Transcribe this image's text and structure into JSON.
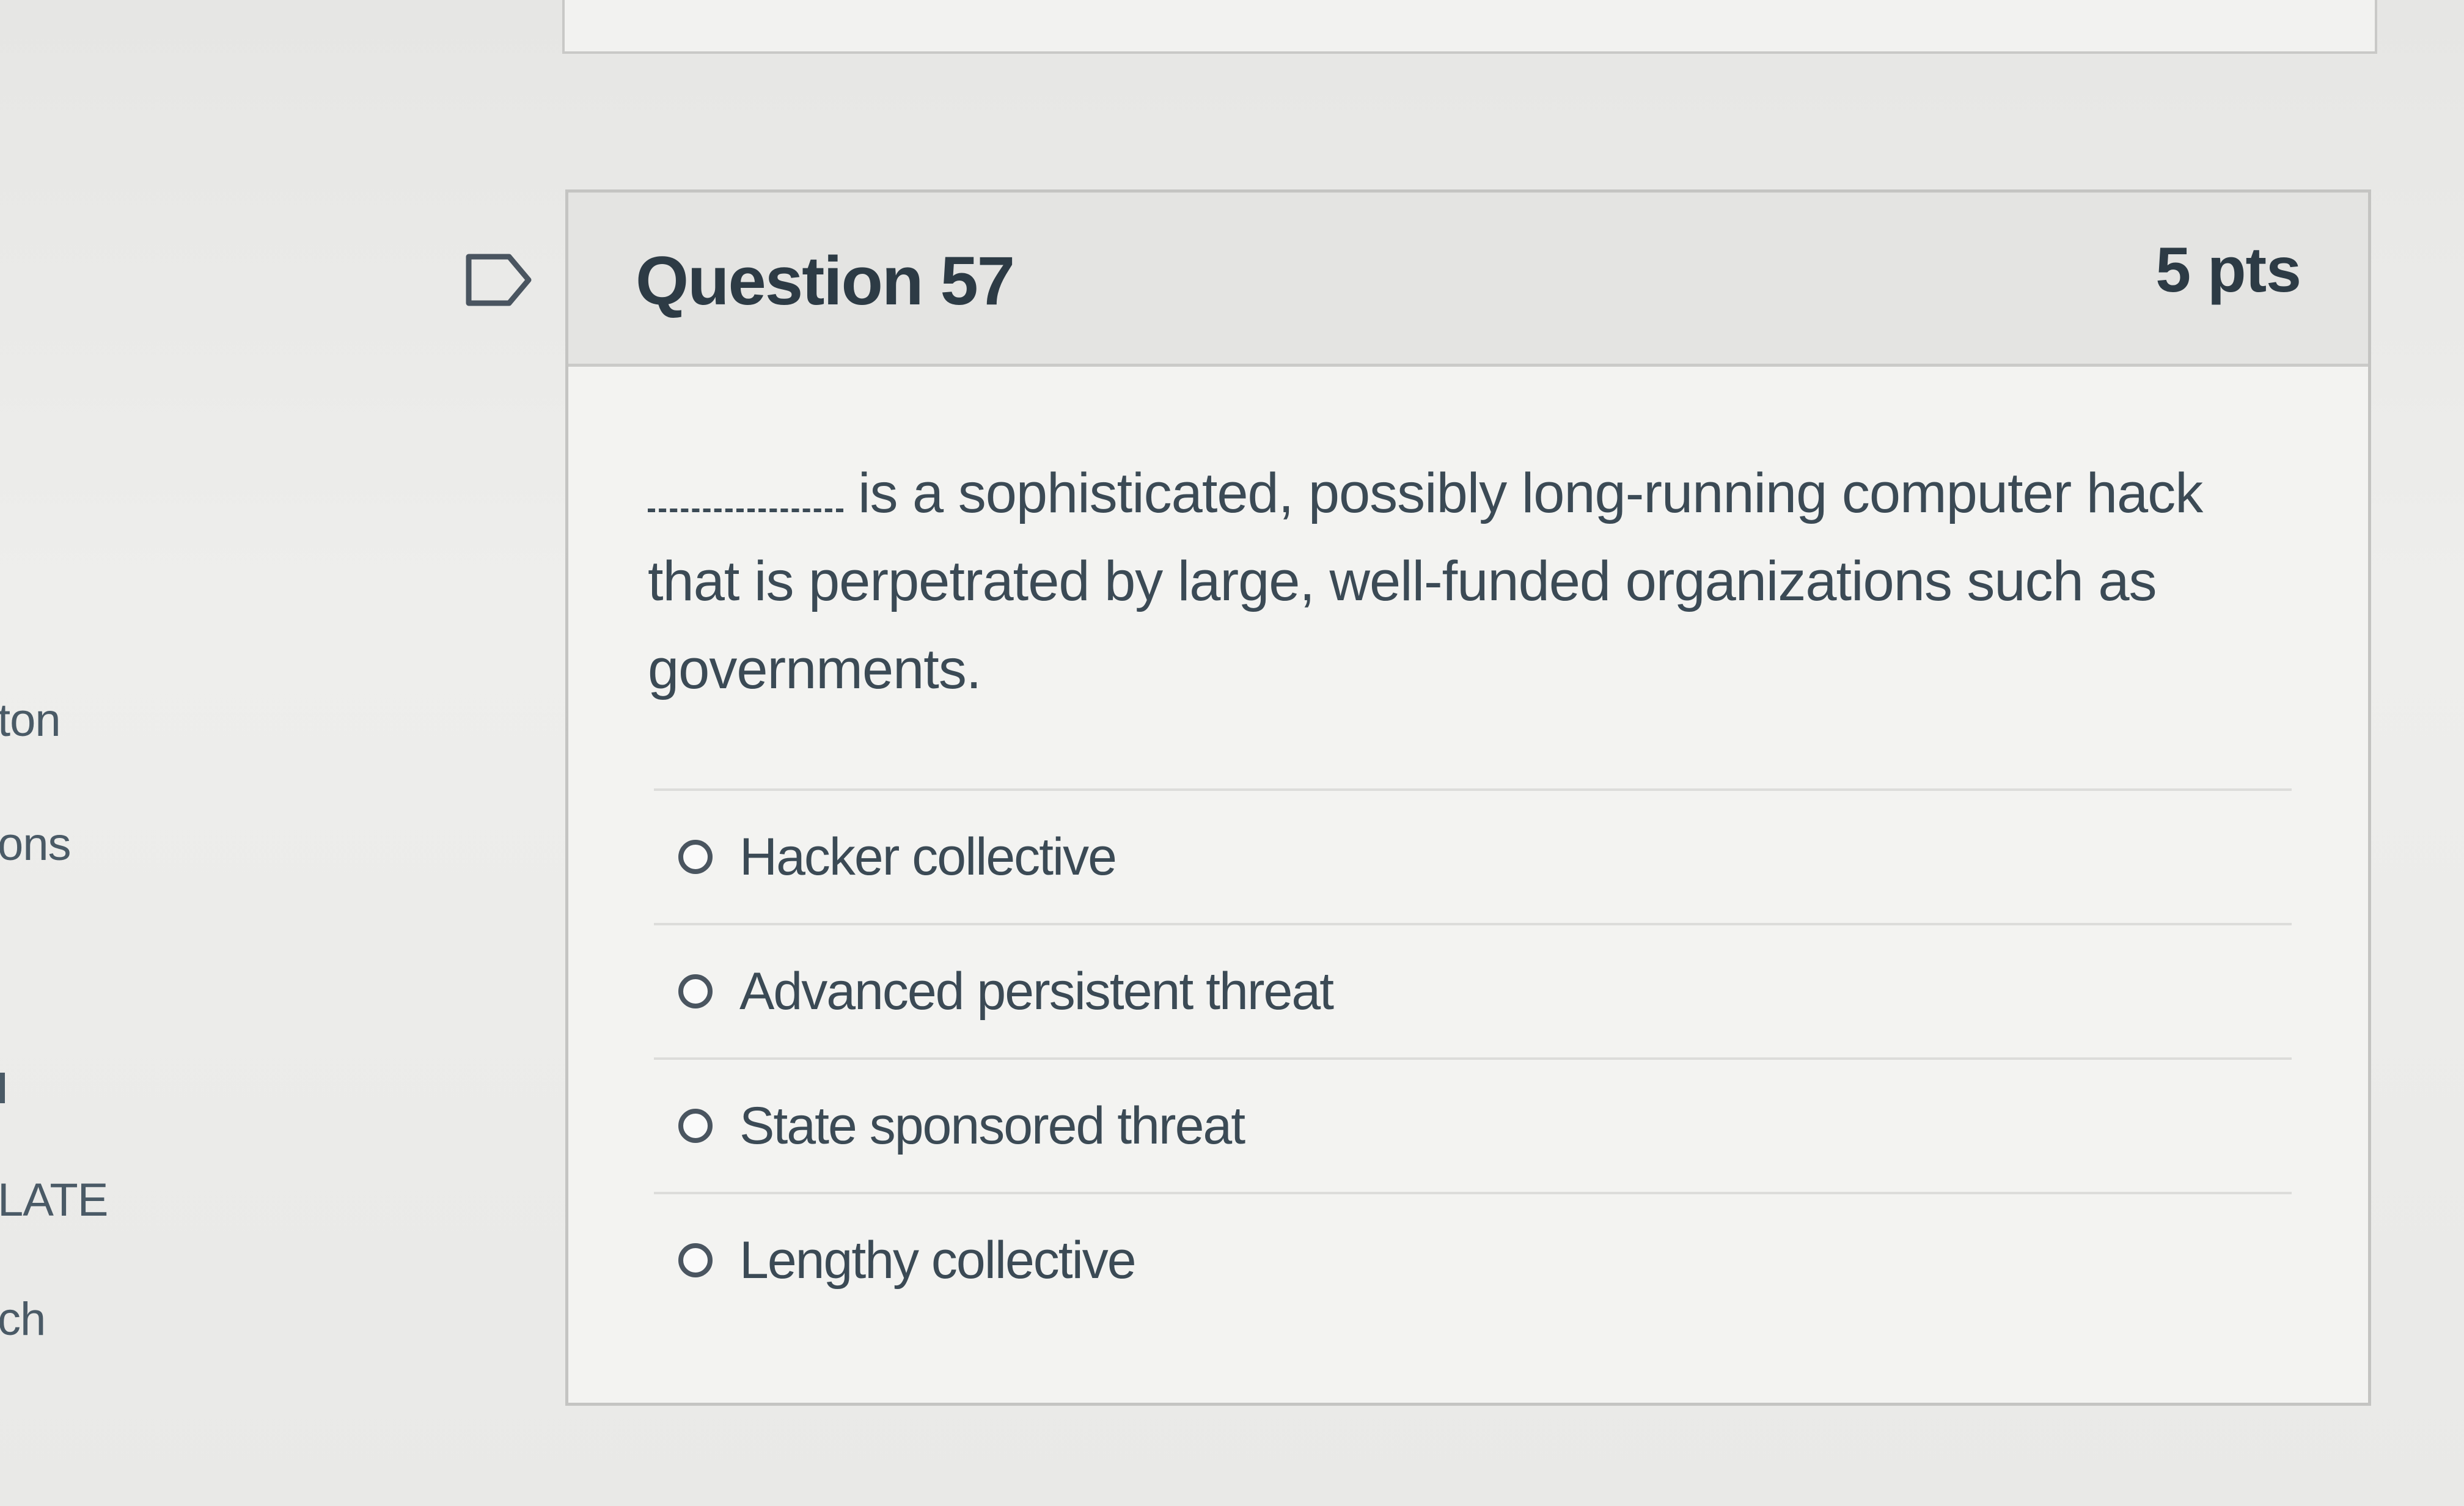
{
  "sidebar": {
    "items": [
      {
        "label": "ton"
      },
      {
        "label": "ons"
      },
      {
        "label": "LATE"
      },
      {
        "label": "ch"
      }
    ]
  },
  "question": {
    "title": "Question 57",
    "points": "5 pts",
    "text": "is a sophisticated, possibly long-running computer hack that is perpetrated by large, well-funded organizations such as governments.",
    "options": [
      {
        "label": "Hacker collective"
      },
      {
        "label": "Advanced persistent threat"
      },
      {
        "label": "State sponsored threat"
      },
      {
        "label": "Lengthy collective"
      }
    ]
  },
  "icons": {
    "flag": "flag-question-icon"
  },
  "colors": {
    "text": "#2d3b45",
    "header_bg": "#e4e4e2",
    "card_bg": "#f3f3f1"
  }
}
